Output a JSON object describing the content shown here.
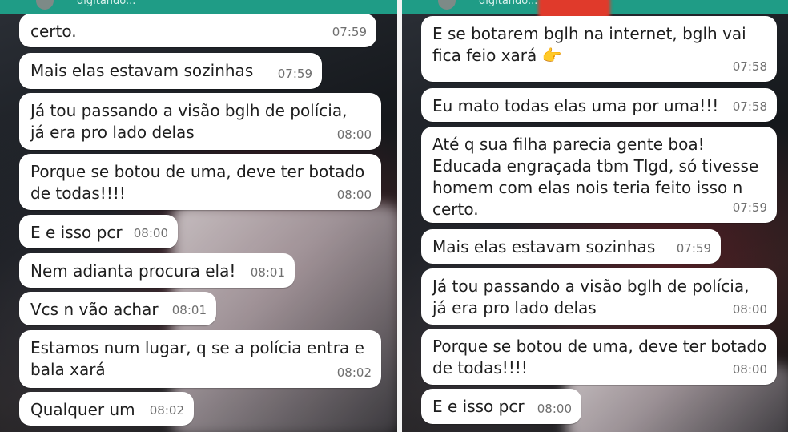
{
  "left": {
    "status": "digitando...",
    "messages": [
      {
        "text": "certo.",
        "time": "07:59"
      },
      {
        "text": "Mais elas estavam sozinhas",
        "time": "07:59"
      },
      {
        "text": "Já tou passando a visão bglh de polícia,\njá era pro lado delas",
        "time": "08:00"
      },
      {
        "text": "Porque se botou de uma, deve ter botado\nde todas!!!!",
        "time": "08:00"
      },
      {
        "text": "E e isso pcr",
        "time": "08:00"
      },
      {
        "text": "Nem adianta procura ela!",
        "time": "08:01"
      },
      {
        "text": "Vcs n vão achar",
        "time": "08:01"
      },
      {
        "text": "Estamos num lugar, q se a polícia entra e\nbala xará",
        "time": "08:02"
      },
      {
        "text": "Qualquer um",
        "time": "08:02"
      }
    ]
  },
  "right": {
    "status": "digitando...",
    "messages": [
      {
        "text": "E se botarem bglh na internet, bglh vai\nfica feio xará 👉",
        "time": "07:58"
      },
      {
        "text": "Eu mato todas elas uma por uma!!!",
        "time": "07:58"
      },
      {
        "text": "Até q sua filha parecia gente boa!\nEducada engraçada tbm Tlgd, só tivesse\nhomem com elas nois teria feito isso n\ncerto.",
        "time": "07:59"
      },
      {
        "text": "Mais elas estavam sozinhas",
        "time": "07:59"
      },
      {
        "text": "Já tou passando a visão bglh de polícia,\njá era pro lado delas",
        "time": "08:00"
      },
      {
        "text": "Porque se botou de uma, deve ter botado\nde todas!!!!",
        "time": "08:00"
      },
      {
        "text": "E e isso pcr",
        "time": "08:00"
      }
    ]
  },
  "colors": {
    "header": "#1f9c86",
    "bubble": "#ffffff",
    "time": "#6f6f6f"
  }
}
